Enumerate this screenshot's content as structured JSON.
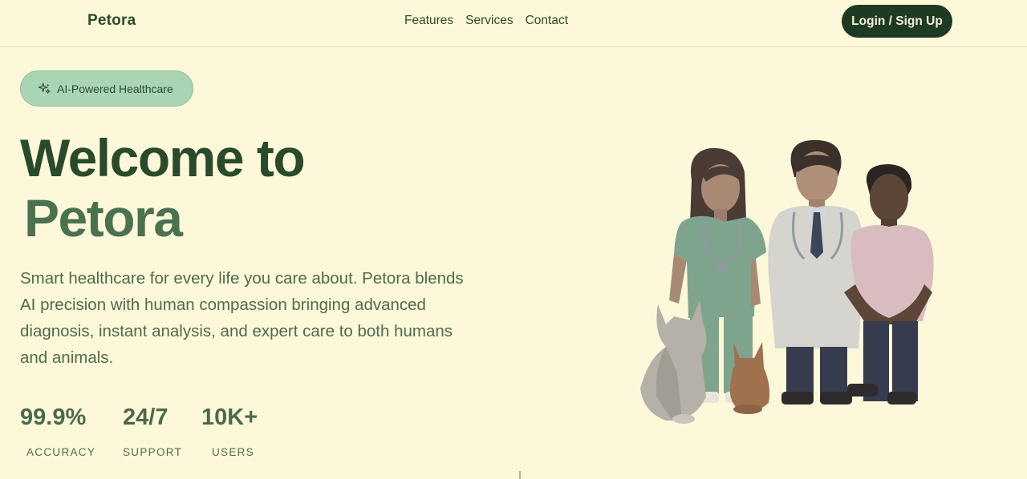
{
  "nav": {
    "brand": "Petora",
    "links": [
      "Features",
      "Services",
      "Contact"
    ],
    "login_label": "Login / Sign Up"
  },
  "hero": {
    "badge": {
      "icon": "sparkle-icon",
      "label": "AI-Powered Healthcare"
    },
    "title_line1": "Welcome to",
    "title_line2": "Petora",
    "description": "Smart healthcare for every life you care about. Petora blends AI precision with human compassion bringing advanced diagnosis, instant analysis, and expert care to both humans and animals.",
    "stats": [
      {
        "value": "99.9%",
        "label": "ACCURACY"
      },
      {
        "value": "24/7",
        "label": "SUPPORT"
      },
      {
        "value": "10K+",
        "label": "USERS"
      }
    ],
    "illustration": {
      "icon": "doctors-and-pets-illustration"
    }
  },
  "colors": {
    "background": "#fdf8d9",
    "primary_dark": "#1f3a23",
    "text_green": "#2d4a2d",
    "accent_green": "#4a7250",
    "badge_bg": "#a9d5b4"
  }
}
